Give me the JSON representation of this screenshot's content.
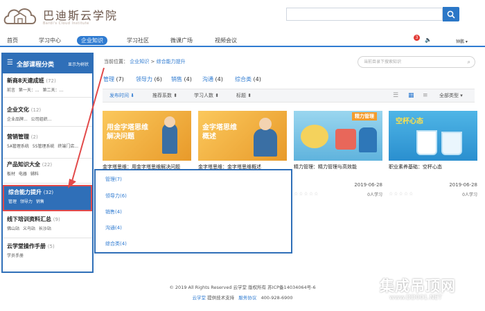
{
  "brand": {
    "name": "巴迪斯云学院",
    "subtitle": "Bardi's Cloud Institute"
  },
  "nav": {
    "items": [
      "首页",
      "学习中心",
      "企业知识",
      "学习社区",
      "微课广场",
      "视频会议"
    ],
    "active_index": 2,
    "badge_count": "3",
    "user": "钟鹏"
  },
  "sidebar": {
    "title": "全部课程分类",
    "toggle": "显示为树状",
    "categories": [
      {
        "name": "新商8天速成班",
        "count": "(72)",
        "subs": "前言 第一天：... 第二天：..."
      },
      {
        "name": "企业文化",
        "count": "(12)",
        "subs": "企业品牌... 公司组织..."
      },
      {
        "name": "营销管理",
        "count": "(2)",
        "subs": "5A管理系统 5S管理系统 终端门店..."
      },
      {
        "name": "产品知识大全",
        "count": "(22)",
        "subs": "板材 电器 辅料"
      },
      {
        "name": "综合能力提升",
        "count": "(32)",
        "subs": "管理 领导力 销售"
      },
      {
        "name": "线下培训资料汇总",
        "count": "(9)",
        "subs": "佛山站 义乌站 长沙站"
      },
      {
        "name": "云学堂操作手册",
        "count": "(5)",
        "subs": "学员手册"
      }
    ]
  },
  "breadcrumb": {
    "label": "当前位置：",
    "root": "企业知识",
    "sep": ">",
    "current": "综合能力提升"
  },
  "knowledge_search": {
    "placeholder": "当前目录下搜索知识"
  },
  "category_tags": [
    {
      "label": "管理",
      "count": "(7)"
    },
    {
      "label": "领导力",
      "count": "(6)"
    },
    {
      "label": "销售",
      "count": "(4)"
    },
    {
      "label": "沟通",
      "count": "(4)"
    },
    {
      "label": "综合类",
      "count": "(4)"
    }
  ],
  "sort": {
    "options": [
      "发布时间",
      "推荐系数",
      "学习人数",
      "标题"
    ],
    "type_filter": "全部类型"
  },
  "cards": [
    {
      "image_text": "用金字塔思维解决问题",
      "title": "金字塔思维：用金字塔思维解决问题",
      "date": "",
      "learners": "",
      "bg": "#f6b042"
    },
    {
      "image_text": "金字塔思维 概述",
      "title": "金字塔思维：金字塔思维概述",
      "date": "",
      "learners": "",
      "bg": "#f6b042"
    },
    {
      "image_text": "精力管理",
      "title": "精力管理：精力管理与高效能",
      "date": "2019-06-28",
      "learners": "0人学习",
      "bg": "#7ec6e8"
    },
    {
      "image_text": "空杯心态",
      "title": "职业素养基础：空杯心态",
      "date": "2019-06-28",
      "learners": "0人学习",
      "bg": "#3ea7df"
    }
  ],
  "stars": "☆☆☆☆☆",
  "dropdown": {
    "items": [
      "管理(7)",
      "领导力(6)",
      "销售(4)",
      "沟通(4)",
      "综合类(4)"
    ]
  },
  "footer": {
    "copyright": "© 2019 All Rights Reserved 云学堂 版权所有 苏ICP备14034064号-6",
    "support_link": "云学堂",
    "support_text": "提供技术支持",
    "service": "服务协议",
    "phone": "400-928-6900"
  },
  "watermark": {
    "title": "集成吊顶网",
    "url": "www.DD001.NET"
  }
}
